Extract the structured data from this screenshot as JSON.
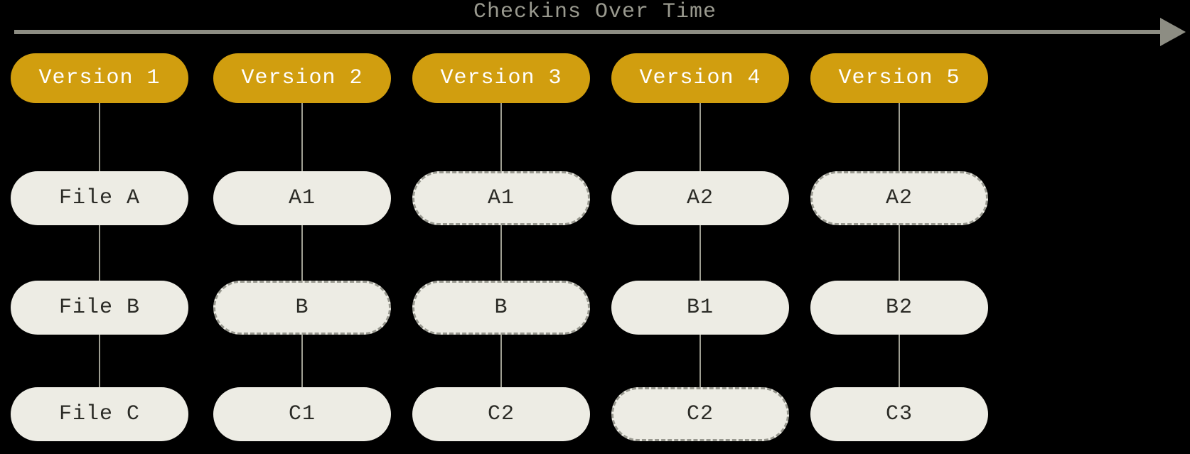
{
  "title": "Checkins Over Time",
  "layout": {
    "colXs": [
      15,
      300,
      580,
      860,
      1140
    ],
    "versionY": 75,
    "fileYs": [
      241,
      395,
      545
    ],
    "lineTop": 145,
    "pillW": 250,
    "vPillH": 70,
    "fPillH": 76
  },
  "columns": [
    {
      "version": "Version 1",
      "files": [
        {
          "label": "File A",
          "dashed": false
        },
        {
          "label": "File B",
          "dashed": false
        },
        {
          "label": "File C",
          "dashed": false
        }
      ]
    },
    {
      "version": "Version 2",
      "files": [
        {
          "label": "A1",
          "dashed": false
        },
        {
          "label": "B",
          "dashed": true
        },
        {
          "label": "C1",
          "dashed": false
        }
      ]
    },
    {
      "version": "Version 3",
      "files": [
        {
          "label": "A1",
          "dashed": true
        },
        {
          "label": "B",
          "dashed": true
        },
        {
          "label": "C2",
          "dashed": false
        }
      ]
    },
    {
      "version": "Version 4",
      "files": [
        {
          "label": "A2",
          "dashed": false
        },
        {
          "label": "B1",
          "dashed": false
        },
        {
          "label": "C2",
          "dashed": true
        }
      ]
    },
    {
      "version": "Version 5",
      "files": [
        {
          "label": "A2",
          "dashed": true
        },
        {
          "label": "B2",
          "dashed": false
        },
        {
          "label": "C3",
          "dashed": false
        }
      ]
    }
  ]
}
